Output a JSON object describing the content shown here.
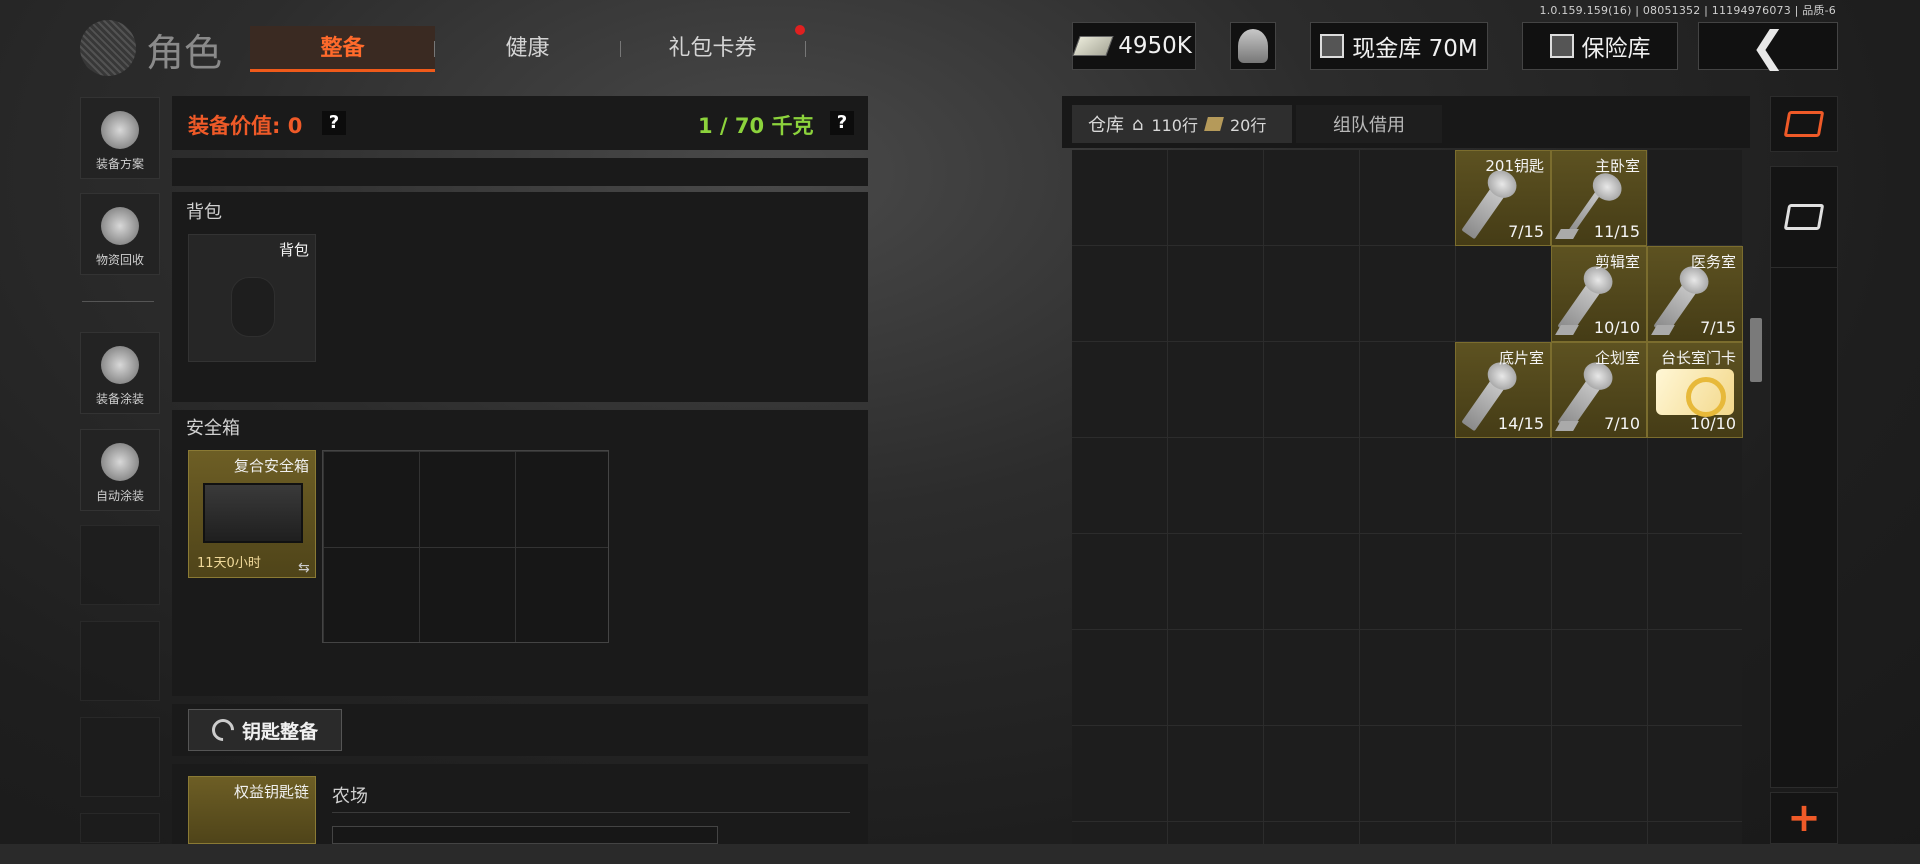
{
  "version": "1.0.159.159(16) | 08051352 | 11194976073 | 品质-6",
  "header": {
    "title": "角色",
    "tabs": [
      {
        "label": "整备",
        "active": true
      },
      {
        "label": "健康",
        "active": false
      },
      {
        "label": "礼包卡券",
        "active": false,
        "notification": true
      }
    ],
    "cash": "4950K",
    "cash_vault": "现金库 70M",
    "safe_vault": "保险库"
  },
  "sidebar": {
    "items": [
      {
        "label": "装备方案"
      },
      {
        "label": "物资回收"
      },
      {
        "label": "装备涂装"
      },
      {
        "label": "自动涂装"
      }
    ]
  },
  "loadout": {
    "value_label": "装备价值: 0",
    "weight_label": "1 / 70 千克",
    "help": "?",
    "backpack": {
      "section": "背包",
      "slot_label": "背包"
    },
    "safebox": {
      "section": "安全箱",
      "item_name": "复合安全箱",
      "timer": "11天0小时"
    },
    "key_button": "钥匙整备",
    "keychain": {
      "item_name": "权益钥匙链",
      "location": "农场"
    }
  },
  "warehouse": {
    "tab_label": "仓库",
    "rows_home": "110行",
    "rows_extra": "20行",
    "team_tab": "组队借用",
    "items": [
      {
        "name": "201钥匙",
        "durability": "7/15",
        "kind": "key"
      },
      {
        "name": "主卧室",
        "durability": "11/15",
        "kind": "key"
      },
      {
        "name": "剪辑室",
        "durability": "10/10",
        "kind": "key"
      },
      {
        "name": "医务室",
        "durability": "7/15",
        "kind": "key"
      },
      {
        "name": "底片室",
        "durability": "14/15",
        "kind": "key"
      },
      {
        "name": "企划室",
        "durability": "7/10",
        "kind": "key"
      },
      {
        "name": "台长室门卡",
        "durability": "10/10",
        "kind": "card"
      }
    ]
  },
  "colors": {
    "accent": "#ef5a28",
    "weight_ok": "#8cd33c",
    "key_gold": "#5d5221"
  }
}
